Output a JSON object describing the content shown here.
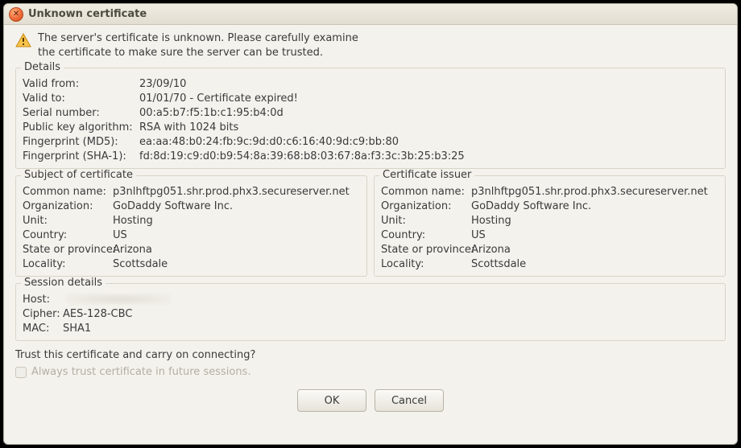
{
  "window": {
    "title": "Unknown certificate"
  },
  "message": {
    "line1": "The server's certificate is unknown. Please carefully examine",
    "line2": "the certificate to make sure the server can be trusted."
  },
  "details": {
    "legend": "Details",
    "valid_from_label": "Valid from:",
    "valid_from": "23/09/10",
    "valid_to_label": "Valid to:",
    "valid_to": "01/01/70 - Certificate expired!",
    "serial_label": "Serial number:",
    "serial": "00:a5:b7:f5:1b:c1:95:b4:0d",
    "pubkey_label": "Public key algorithm:",
    "pubkey": "RSA with 1024 bits",
    "md5_label": "Fingerprint (MD5):",
    "md5": "ea:aa:48:b0:24:fb:9c:9d:d0:c6:16:40:9d:c9:bb:80",
    "sha1_label": "Fingerprint (SHA-1):",
    "sha1": "fd:8d:19:c9:d0:b9:54:8a:39:68:b8:03:67:8a:f3:3c:3b:25:b3:25"
  },
  "subject": {
    "legend": "Subject of certificate",
    "cn_label": "Common name:",
    "cn": "p3nlhftpg051.shr.prod.phx3.secureserver.net",
    "org_label": "Organization:",
    "org": "GoDaddy Software Inc.",
    "unit_label": "Unit:",
    "unit": "Hosting",
    "country_label": "Country:",
    "country": "US",
    "state_label": "State or province:",
    "state": "Arizona",
    "locality_label": "Locality:",
    "locality": "Scottsdale"
  },
  "issuer": {
    "legend": "Certificate issuer",
    "cn_label": "Common name:",
    "cn": "p3nlhftpg051.shr.prod.phx3.secureserver.net",
    "org_label": "Organization:",
    "org": "GoDaddy Software Inc.",
    "unit_label": "Unit:",
    "unit": "Hosting",
    "country_label": "Country:",
    "country": "US",
    "state_label": "State or province:",
    "state": "Arizona",
    "locality_label": "Locality:",
    "locality": "Scottsdale"
  },
  "session": {
    "legend": "Session details",
    "host_label": "Host:",
    "cipher_label": "Cipher:",
    "cipher": "AES-128-CBC",
    "mac_label": "MAC:",
    "mac": "SHA1"
  },
  "trust": {
    "question": "Trust this certificate and carry on connecting?",
    "always_label": "Always trust certificate in future sessions."
  },
  "buttons": {
    "ok": "OK",
    "cancel": "Cancel"
  }
}
